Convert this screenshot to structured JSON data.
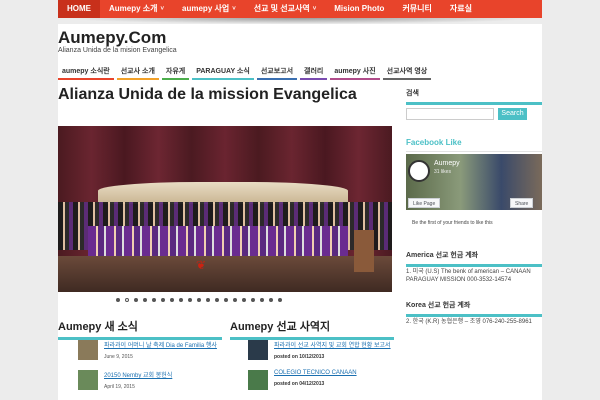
{
  "topnav": {
    "items": [
      {
        "label": "HOME",
        "caret": ""
      },
      {
        "label": "Aumepy 소개",
        "caret": "˅"
      },
      {
        "label": "aumepy 사업",
        "caret": "˅"
      },
      {
        "label": "선교 및 선교사역",
        "caret": "˅"
      },
      {
        "label": "Mision Photo",
        "caret": ""
      },
      {
        "label": "커뮤니티",
        "caret": ""
      },
      {
        "label": "자료실",
        "caret": ""
      }
    ]
  },
  "site": {
    "title": "Aumepy.Com",
    "tagline": "Alianza Unida de la mision Evangelica"
  },
  "categories": [
    {
      "label": "aumepy 소식란",
      "color": "#e8442b"
    },
    {
      "label": "선교사 소개",
      "color": "#f2a12a"
    },
    {
      "label": "자유게",
      "color": "#4cae4c"
    },
    {
      "label": "PARAGUAY 소식",
      "color": "#4cc0c6"
    },
    {
      "label": "선교보고서",
      "color": "#3a6fb0"
    },
    {
      "label": "갤러리",
      "color": "#7a4cb0"
    },
    {
      "label": "aumepy 사진",
      "color": "#b04c8a"
    },
    {
      "label": "선교사역 영상",
      "color": "#666"
    }
  ],
  "post": {
    "title": "Alianza Unida de la mission Evangelica"
  },
  "slider": {
    "dot_count": 19,
    "active_dot": 1
  },
  "section_left": {
    "heading": "Aumepy 새 소식",
    "items": [
      {
        "title": "파라과이 어머니 날 축제 Dia de Familia 행사",
        "date": "June 9, 2015",
        "thumb_color": "#8a7a5a"
      },
      {
        "title": "20150 Nemby 교회 봉헌식",
        "date": "April 19, 2015",
        "thumb_color": "#6a8a5a"
      }
    ]
  },
  "section_right": {
    "heading": "Aumepy 선교 사역지",
    "items": [
      {
        "title": "파라과이 선교 사역지 및 교회 연합 현황 보고서",
        "date": "posted on 10/12/2013",
        "thumb_color": "#2a3a4a"
      },
      {
        "title": "COLEGIO TECNICO CANAAN",
        "date": "posted on 04/12/2013",
        "thumb_color": "#4a7a4a"
      }
    ]
  },
  "sidebar": {
    "search": {
      "label": "검색",
      "placeholder": "",
      "button": "Search"
    },
    "facebook": {
      "title": "Facebook Like",
      "page_name": "Aumepy",
      "likes": "31 likes",
      "like_button": "Like Page",
      "share_button": "Share",
      "first_text": "Be the first of your friends to like this"
    },
    "america": {
      "title": "America 선교 헌금 계좌",
      "text": "1. 미국 (U.S) The benk of american – CANAAN PARAGUAY MISSION 000-3532-14574"
    },
    "korea": {
      "title": "Korea 선교 헌금 계좌",
      "text": "2. 한국 (K.R) 농협은행 – 조영 076-240-255-8961"
    }
  }
}
